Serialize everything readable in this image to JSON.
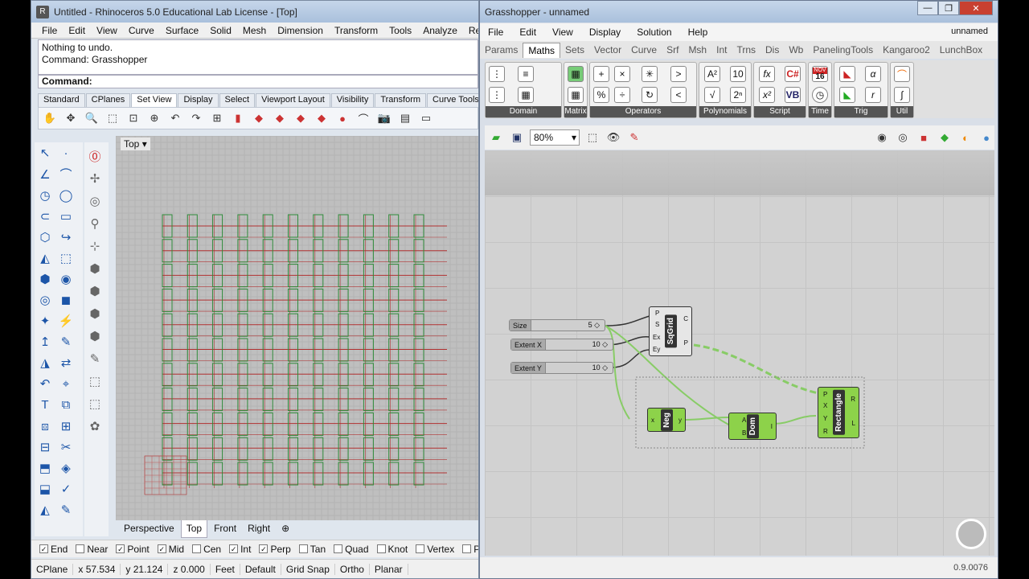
{
  "rhino": {
    "title": "Untitled - Rhinoceros 5.0 Educational Lab License - [Top]",
    "menu": [
      "File",
      "Edit",
      "View",
      "Curve",
      "Surface",
      "Solid",
      "Mesh",
      "Dimension",
      "Transform",
      "Tools",
      "Analyze",
      "Render"
    ],
    "history": [
      "Nothing to undo.",
      "Command: Grasshopper"
    ],
    "command_label": "Command:",
    "toolbar_tabs": [
      "Standard",
      "CPlanes",
      "Set View",
      "Display",
      "Select",
      "Viewport Layout",
      "Visibility",
      "Transform",
      "Curve Tools"
    ],
    "active_toolbar_tab": "Set View",
    "viewport_label": "Top",
    "viewport_tabs": [
      "Perspective",
      "Top",
      "Front",
      "Right"
    ],
    "osnaps": [
      {
        "label": "End",
        "checked": true
      },
      {
        "label": "Near",
        "checked": false
      },
      {
        "label": "Point",
        "checked": true
      },
      {
        "label": "Mid",
        "checked": true
      },
      {
        "label": "Cen",
        "checked": false
      },
      {
        "label": "Int",
        "checked": true
      },
      {
        "label": "Perp",
        "checked": true
      },
      {
        "label": "Tan",
        "checked": false
      },
      {
        "label": "Quad",
        "checked": false
      },
      {
        "label": "Knot",
        "checked": false
      },
      {
        "label": "Vertex",
        "checked": false
      },
      {
        "label": "Project",
        "checked": false
      }
    ],
    "status": [
      "CPlane",
      "x 57.534",
      "y 21.124",
      "z 0.000",
      "Feet",
      "Default",
      "Grid Snap",
      "Ortho",
      "Planar"
    ]
  },
  "gh": {
    "title": "Grasshopper - unnamed",
    "menu": [
      "File",
      "Edit",
      "View",
      "Display",
      "Solution",
      "Help"
    ],
    "doc_name": "unnamed",
    "tabs": [
      "Params",
      "Maths",
      "Sets",
      "Vector",
      "Curve",
      "Srf",
      "Msh",
      "Int",
      "Trns",
      "Dis",
      "Wb",
      "PanelingTools",
      "Kangaroo2",
      "LunchBox"
    ],
    "active_tab": "Maths",
    "groups": [
      "Domain",
      "Matrix",
      "Operators",
      "Polynomials",
      "Script",
      "Time",
      "Trig",
      "Util"
    ],
    "zoom": "80%",
    "version": "0.9.0076",
    "sliders": [
      {
        "name": "Size",
        "value": "5 ◇"
      },
      {
        "name": "Extent X",
        "value": "10 ◇"
      },
      {
        "name": "Extent Y",
        "value": "10 ◇"
      }
    ],
    "sqgrid": {
      "name": "SqGrid",
      "inputs": [
        "P",
        "S",
        "Ex",
        "Ey"
      ],
      "outputs": [
        "C",
        "P"
      ]
    },
    "neg": {
      "name": "Neg",
      "in": "x",
      "out": "y"
    },
    "dom": {
      "name": "Dom",
      "inputs": [
        "A",
        "B"
      ],
      "out": "I"
    },
    "rect": {
      "name": "Rectangle",
      "inputs": [
        "P",
        "X",
        "Y",
        "R"
      ],
      "outputs": [
        "R",
        "L"
      ]
    },
    "script_icons": [
      "fx",
      "C#",
      "x²",
      "VB"
    ],
    "calendar": {
      "month": "NOV",
      "day": "16"
    }
  },
  "icons": {
    "rhino_app": "rhino-icon",
    "hand": "pan-icon",
    "zoom": "zoom-icon",
    "camera": "camera-icon",
    "open": "open-file-icon",
    "save": "save-file-icon",
    "eye": "preview-icon"
  },
  "colors": {
    "grid_green": "#2e8b3a",
    "grid_red": "#b03030",
    "gh_green": "#8dd24a"
  }
}
